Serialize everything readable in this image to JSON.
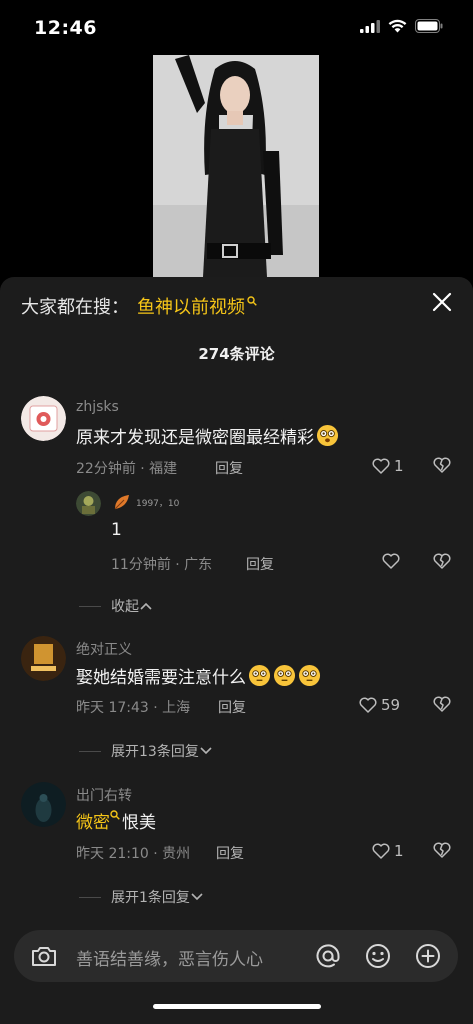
{
  "status_bar": {
    "time": "12:46"
  },
  "search_banner": {
    "prefix": "大家都在搜：",
    "term": "鱼神以前视频"
  },
  "comments_header": {
    "count_label": "274条评论"
  },
  "comments": [
    {
      "username": "zhjsks",
      "text": "原来才发现还是微密圈最经精彩",
      "time_location": "22分钟前 · 福建",
      "reply_label": "回复",
      "likes": "1",
      "replies": [
        {
          "tag": "1997，10",
          "text": "1",
          "time_location": "11分钟前 · 广东",
          "reply_label": "回复"
        }
      ],
      "collapse_label": "收起"
    },
    {
      "username": "绝对正义",
      "text": "娶她结婚需要注意什么",
      "time_location": "昨天 17:43 · 上海",
      "reply_label": "回复",
      "likes": "59",
      "expand_label": "展开13条回复"
    },
    {
      "username": "出门右转",
      "text_link": "微密",
      "text_rest": "恨美",
      "time_location": "昨天 21:10 · 贵州",
      "reply_label": "回复",
      "likes": "1",
      "expand_label": "展开1条回复"
    }
  ],
  "input_bar": {
    "placeholder": "善语结善缘，恶言伤人心"
  }
}
